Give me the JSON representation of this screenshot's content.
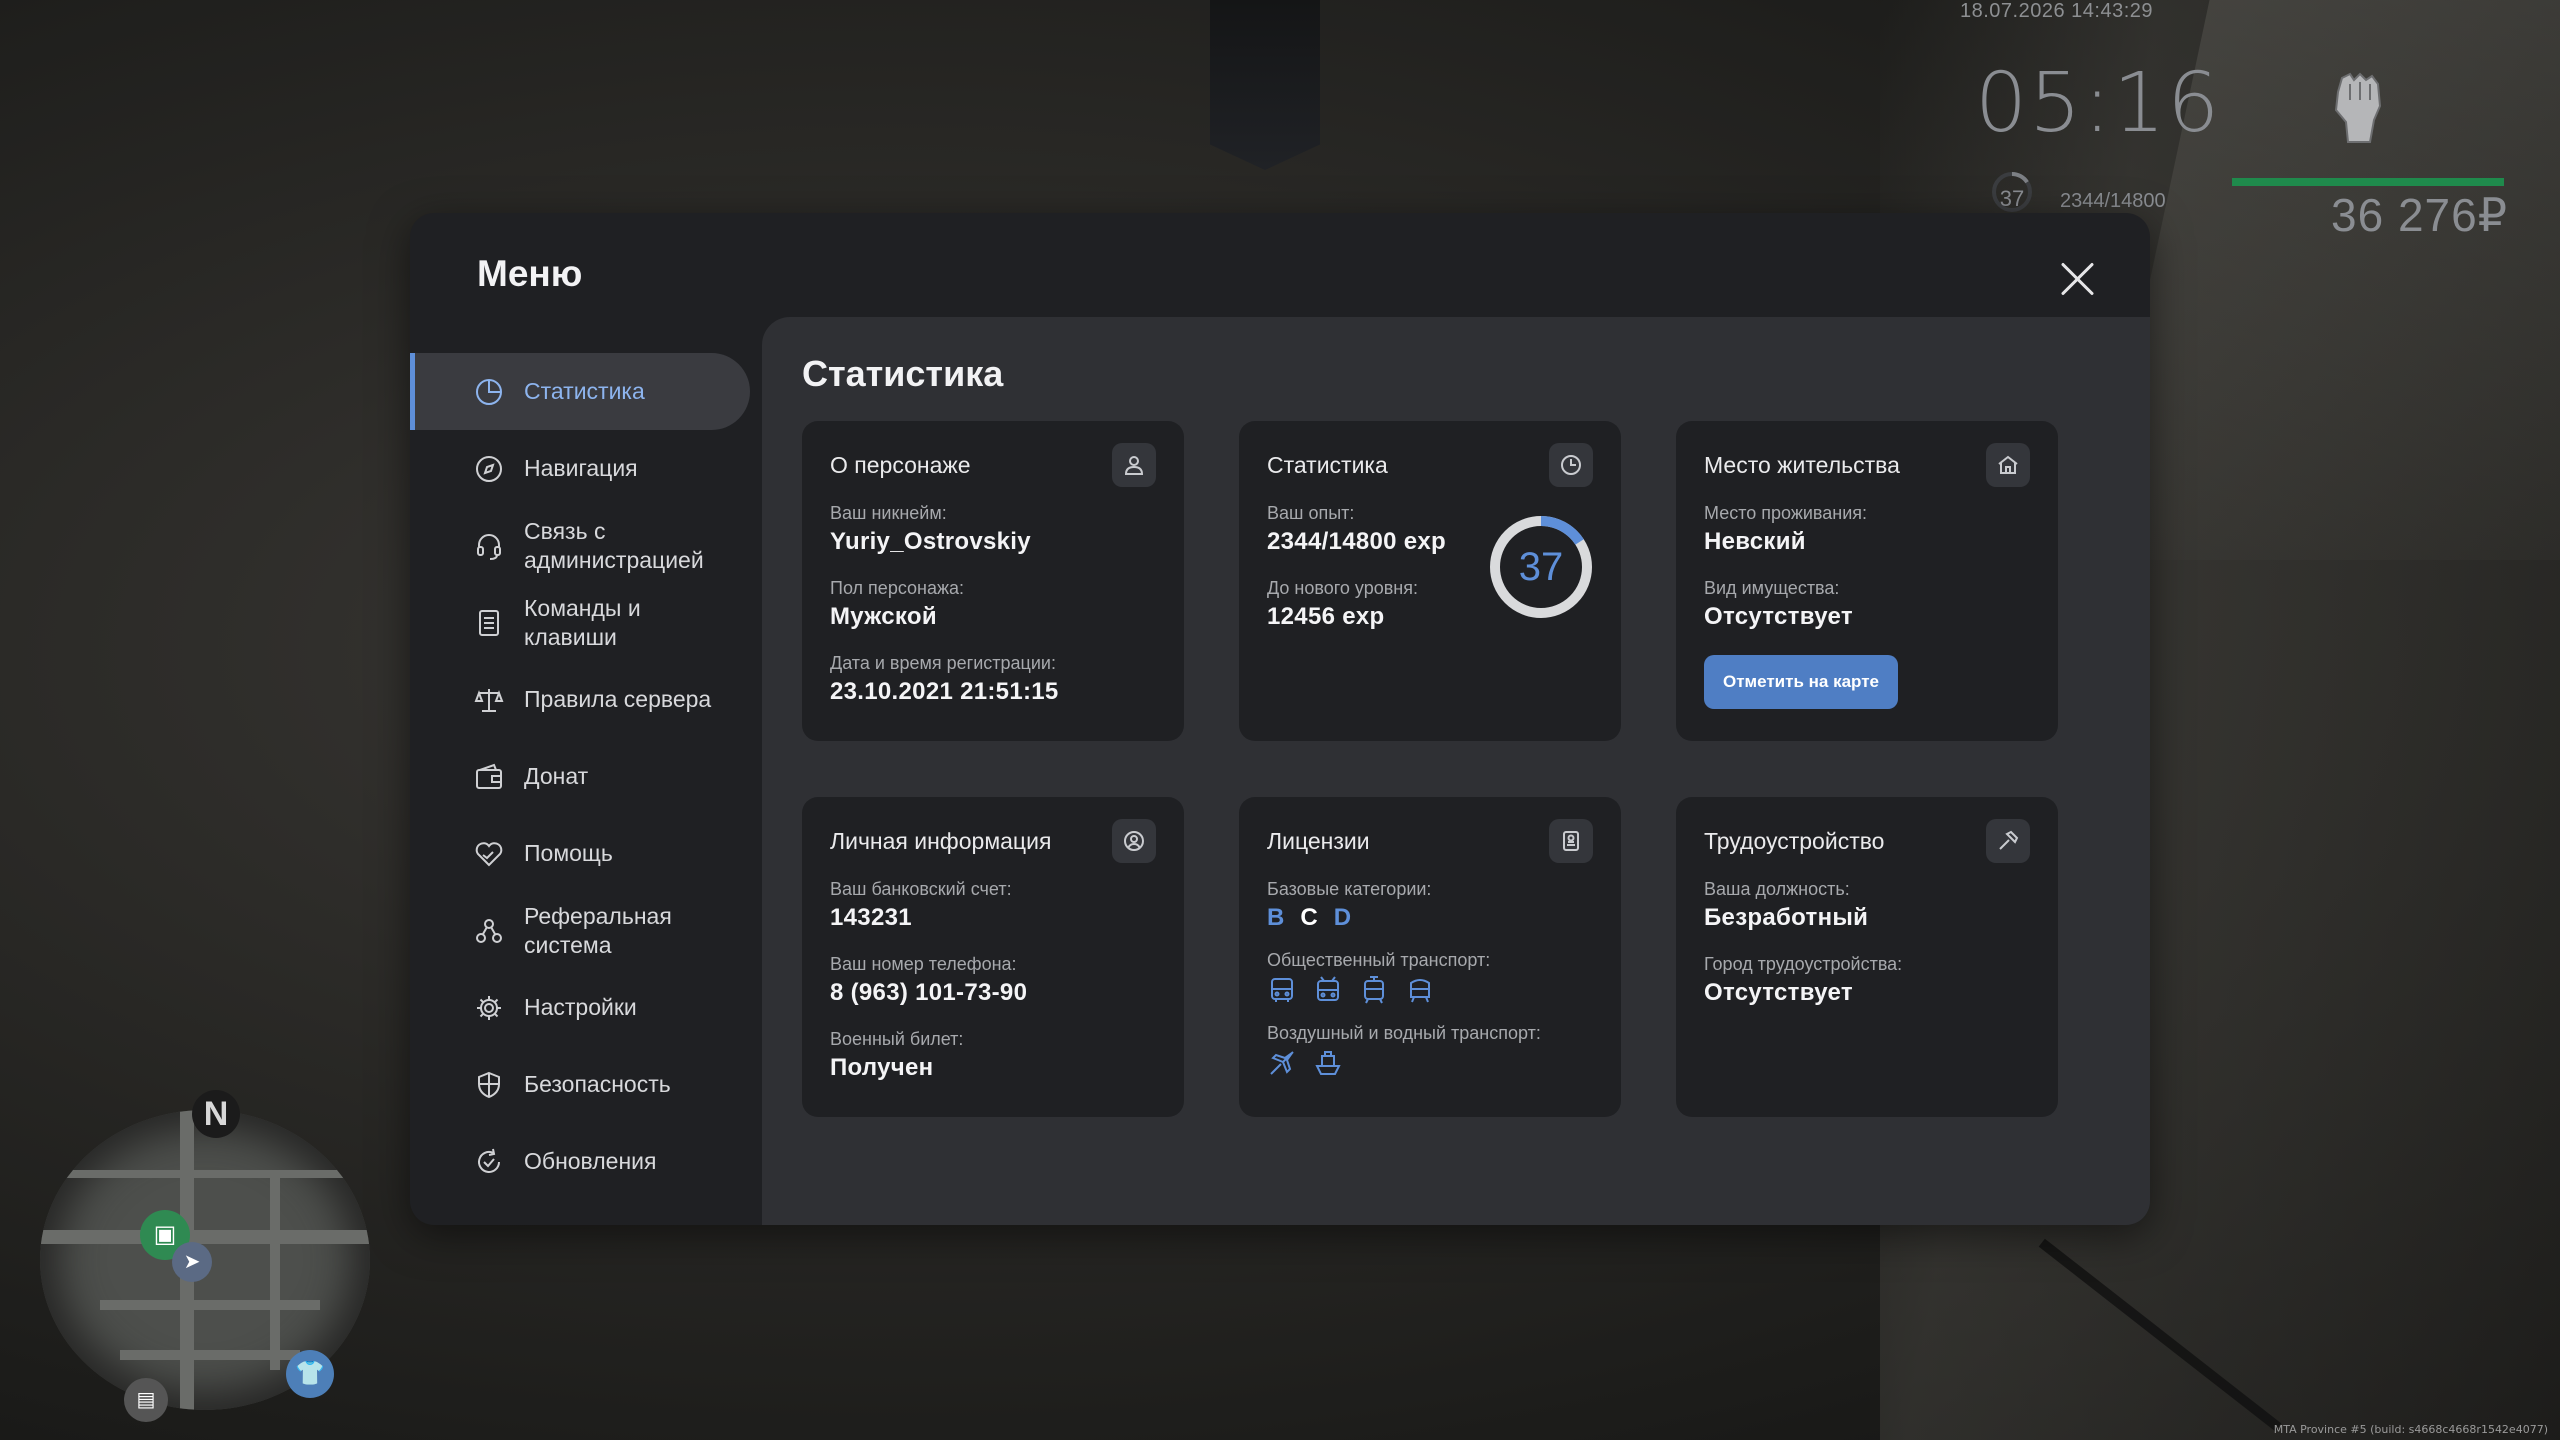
{
  "hud": {
    "datetime": "18.07.2026 14:43:29",
    "clock": "05:16",
    "level": "37",
    "exp": "2344/14800",
    "health": 1.0,
    "money": "36 276₽",
    "minimap_north": "N",
    "build_info": "MTA Province #5 (build: s4668c4668r1542e4077)"
  },
  "menu": {
    "title": "Меню",
    "close_icon": "close-icon"
  },
  "sidebar": {
    "items": [
      {
        "label": "Статистика",
        "icon": "pie-chart-icon",
        "active": true
      },
      {
        "label": "Навигация",
        "icon": "compass-icon"
      },
      {
        "label": "Связь с администрацией",
        "icon": "headset-icon"
      },
      {
        "label": "Команды и клавиши",
        "icon": "document-list-icon"
      },
      {
        "label": "Правила сервера",
        "icon": "scales-icon"
      },
      {
        "label": "Донат",
        "icon": "wallet-icon"
      },
      {
        "label": "Помощь",
        "icon": "handshake-heart-icon"
      },
      {
        "label": "Реферальная система",
        "icon": "people-network-icon"
      },
      {
        "label": "Настройки",
        "icon": "gear-icon"
      },
      {
        "label": "Безопасность",
        "icon": "shield-icon"
      },
      {
        "label": "Обновления",
        "icon": "refresh-check-icon"
      }
    ]
  },
  "content": {
    "title": "Статистика",
    "character": {
      "title": "О персонаже",
      "icon": "user-icon",
      "nickname_label": "Ваш никнейм:",
      "nickname": "Yuriy_Ostrovskiy",
      "gender_label": "Пол персонажа:",
      "gender": "Мужской",
      "reg_label": "Дата и время регистрации:",
      "reg_date": "23.10.2021 21:51:15"
    },
    "stats": {
      "title": "Статистика",
      "icon": "clock-pie-icon",
      "exp_label": "Ваш опыт:",
      "exp": "2344/14800 exp",
      "next_label": "До нового уровня:",
      "next": "12456 exp",
      "level": "37",
      "progress": 0.158,
      "accent": "#5e8fd9"
    },
    "residence": {
      "title": "Место жительства",
      "icon": "house-icon",
      "place_label": "Место проживания:",
      "place": "Невский",
      "property_label": "Вид имущества:",
      "property": "Отсутствует",
      "button": "Отметить на карте"
    },
    "personal": {
      "title": "Личная информация",
      "icon": "user-circle-icon",
      "bank_label": "Ваш банковский счет:",
      "bank": "143231",
      "phone_label": "Ваш номер телефона:",
      "phone": "8 (963) 101-73-90",
      "military_label": "Военный билет:",
      "military": "Получен"
    },
    "licenses": {
      "title": "Лицензии",
      "icon": "id-card-icon",
      "base_label": "Базовые категории:",
      "categories": [
        {
          "label": "B",
          "color": "#5e8fd9"
        },
        {
          "label": "C",
          "color": "#ffffff"
        },
        {
          "label": "D",
          "color": "#5e8fd9"
        }
      ],
      "public_label": "Общественный транспорт:",
      "air_label": "Воздушный и водный транспорт:"
    },
    "employment": {
      "title": "Трудоустройство",
      "icon": "hammer-icon",
      "position_label": "Ваша должность:",
      "position": "Безработный",
      "city_label": "Город трудоустройства:",
      "city": "Отсутствует"
    }
  }
}
